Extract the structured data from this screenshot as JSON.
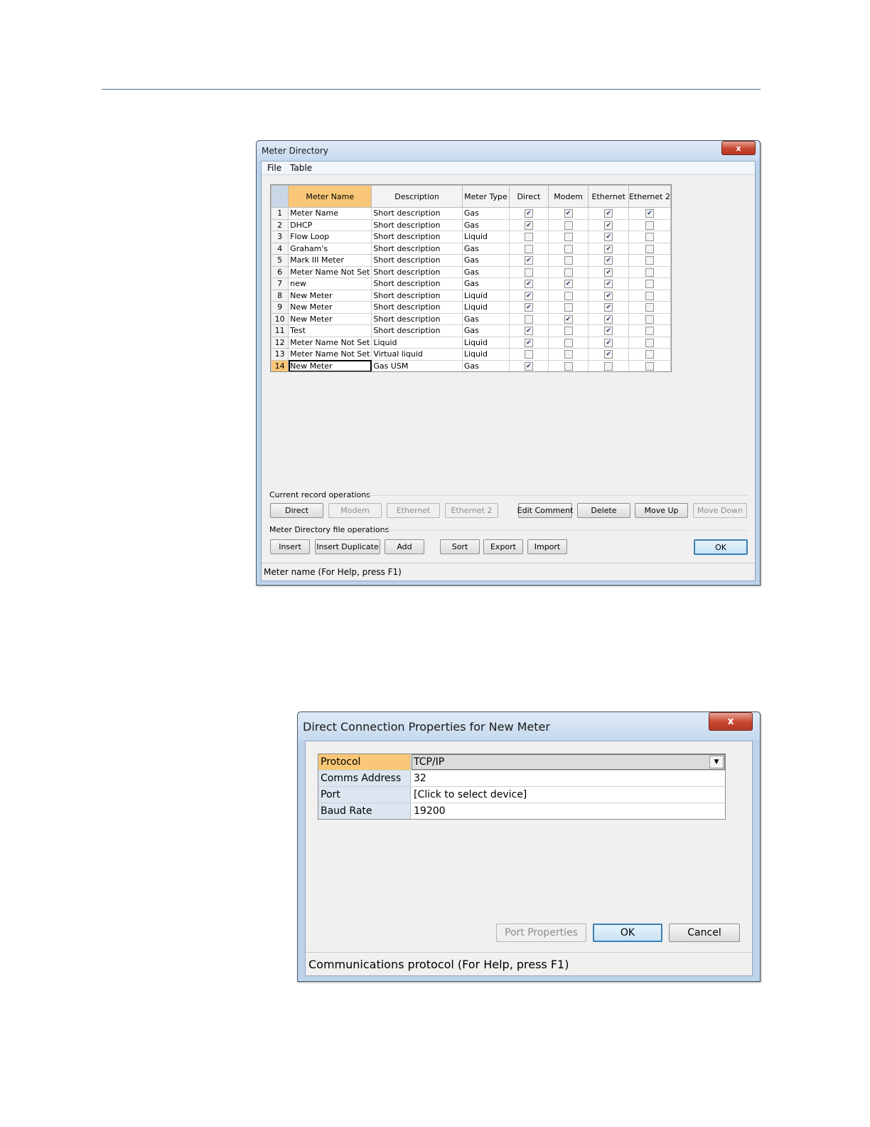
{
  "meter_directory": {
    "title": "Meter Directory",
    "close_symbol": "x",
    "menu": [
      "File",
      "Table"
    ],
    "columns": [
      "Meter Name",
      "Description",
      "Meter Type",
      "Direct",
      "Modem",
      "Ethernet",
      "Ethernet 2"
    ],
    "rows": [
      {
        "n": "1",
        "name": "Meter Name",
        "desc": "Short description",
        "type": "Gas",
        "direct": true,
        "modem": true,
        "ethernet": true,
        "ethernet2": true
      },
      {
        "n": "2",
        "name": "DHCP",
        "desc": "Short description",
        "type": "Gas",
        "direct": true,
        "modem": false,
        "ethernet": true,
        "ethernet2": false
      },
      {
        "n": "3",
        "name": "Flow Loop",
        "desc": "Short description",
        "type": "Liquid",
        "direct": false,
        "modem": false,
        "ethernet": true,
        "ethernet2": false
      },
      {
        "n": "4",
        "name": "Graham's",
        "desc": "Short description",
        "type": "Gas",
        "direct": false,
        "modem": false,
        "ethernet": true,
        "ethernet2": false
      },
      {
        "n": "5",
        "name": "Mark III Meter",
        "desc": "Short description",
        "type": "Gas",
        "direct": true,
        "modem": false,
        "ethernet": true,
        "ethernet2": false
      },
      {
        "n": "6",
        "name": "Meter Name Not Set",
        "desc": "Short description",
        "type": "Gas",
        "direct": false,
        "modem": false,
        "ethernet": true,
        "ethernet2": false
      },
      {
        "n": "7",
        "name": "new",
        "desc": "Short description",
        "type": "Gas",
        "direct": true,
        "modem": true,
        "ethernet": true,
        "ethernet2": false
      },
      {
        "n": "8",
        "name": "New Meter",
        "desc": "Short description",
        "type": "Liquid",
        "direct": true,
        "modem": false,
        "ethernet": true,
        "ethernet2": false
      },
      {
        "n": "9",
        "name": "New Meter",
        "desc": "Short description",
        "type": "Liquid",
        "direct": true,
        "modem": false,
        "ethernet": true,
        "ethernet2": false
      },
      {
        "n": "10",
        "name": "New Meter",
        "desc": "Short description",
        "type": "Gas",
        "direct": false,
        "modem": true,
        "ethernet": true,
        "ethernet2": false
      },
      {
        "n": "11",
        "name": "Test",
        "desc": "Short description",
        "type": "Gas",
        "direct": true,
        "modem": false,
        "ethernet": true,
        "ethernet2": false
      },
      {
        "n": "12",
        "name": "Meter Name Not Set",
        "desc": "Liquid",
        "type": "Liquid",
        "direct": true,
        "modem": false,
        "ethernet": true,
        "ethernet2": false
      },
      {
        "n": "13",
        "name": "Meter Name Not Set",
        "desc": "Virtual liquid",
        "type": "Liquid",
        "direct": false,
        "modem": false,
        "ethernet": true,
        "ethernet2": false
      },
      {
        "n": "14",
        "name": "New Meter",
        "desc": "Gas USM",
        "type": "Gas",
        "direct": true,
        "modem": false,
        "ethernet": false,
        "ethernet2": false
      }
    ],
    "selected_row": "14",
    "current_record_label": "Current record operations",
    "record_buttons": [
      {
        "label": "Direct",
        "enabled": true
      },
      {
        "label": "Modem",
        "enabled": false
      },
      {
        "label": "Ethernet",
        "enabled": false
      },
      {
        "label": "Ethernet 2",
        "enabled": false
      },
      {
        "label": "Edit Comment",
        "enabled": true
      },
      {
        "label": "Delete",
        "enabled": true
      },
      {
        "label": "Move Up",
        "enabled": true
      },
      {
        "label": "Move Down",
        "enabled": false
      }
    ],
    "file_ops_label": "Meter Directory file operations",
    "file_buttons": [
      "Insert",
      "Insert Duplicate",
      "Add",
      "Sort",
      "Export",
      "Import"
    ],
    "ok_label": "OK",
    "status": "Meter name (For Help, press F1)"
  },
  "direct_connection": {
    "title": "Direct Connection Properties for New Meter",
    "close_symbol": "x",
    "properties": [
      {
        "key": "Protocol",
        "value": "TCP/IP"
      },
      {
        "key": "Comms Address",
        "value": "32"
      },
      {
        "key": "Port",
        "value": "[Click to select device]"
      },
      {
        "key": "Baud Rate",
        "value": "19200"
      }
    ],
    "port_properties_label": "Port Properties",
    "ok_label": "OK",
    "cancel_label": "Cancel",
    "status": "Communications protocol (For Help, press F1)"
  },
  "colors": {
    "selection": "#f9c777",
    "title_bar": "#c6d9ee",
    "close_button": "#c8452f",
    "default_button_border": "#3c7fb1"
  }
}
